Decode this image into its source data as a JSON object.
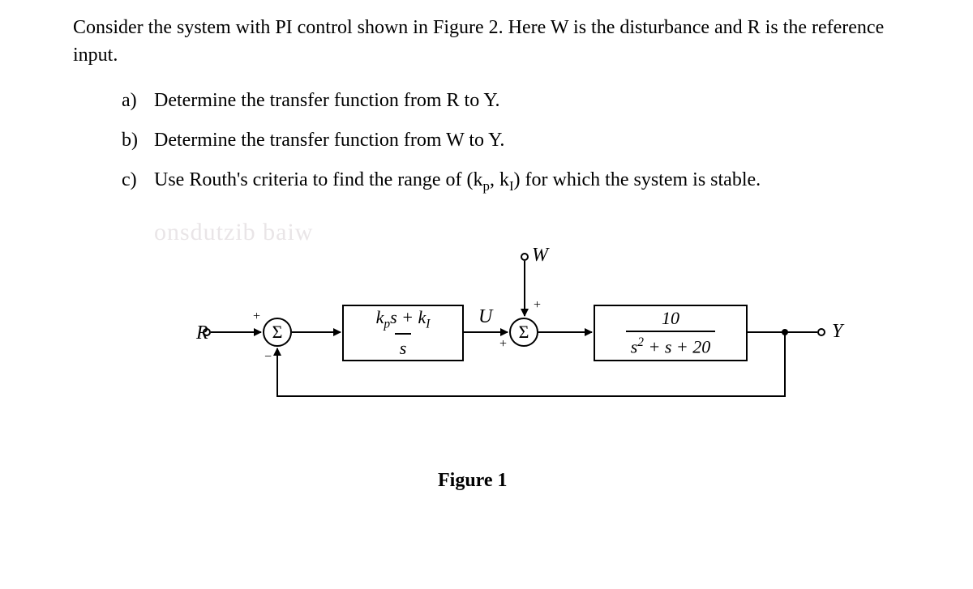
{
  "intro": "Consider the system with PI control shown in Figure 2. Here W is the disturbance and R is the reference input.",
  "parts": {
    "a": {
      "label": "a)",
      "text": "Determine the transfer function from R to Y."
    },
    "b": {
      "label": "b)",
      "text": "Determine the transfer function from W to Y."
    },
    "c": {
      "label": "c)",
      "text_prefix": "Use Routh's criteria to find the range of (k",
      "kp_sub": "p",
      "mid": ", k",
      "ki_sub": "I",
      "text_suffix": ") for which the system is stable."
    }
  },
  "diagram": {
    "input_R": "R",
    "input_W": "W",
    "signal_U": "U",
    "output_Y": "Y",
    "sum_symbol": "Σ",
    "controller_num_prefix": "k",
    "controller_kp_sub": "p",
    "controller_num_mid": "s + k",
    "controller_ki_sub": "I",
    "controller_den": "s",
    "plant_num": "10",
    "plant_den_prefix": "s",
    "plant_den_sup": "2",
    "plant_den_suffix": " + s + 20",
    "sign_plus": "+",
    "sign_minus": "−"
  },
  "caption": "Figure 1",
  "watermarks": {
    "wm1": "onsdutzib baiw",
    "wm2": "",
    "wm3": "",
    "wm4": "",
    "wm5": "",
    "wm6": ""
  }
}
